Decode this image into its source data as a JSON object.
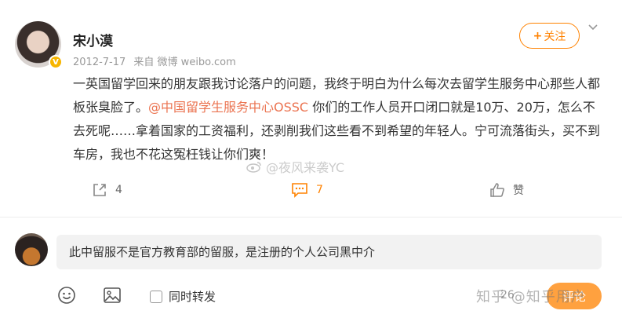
{
  "post": {
    "username": "宋小漠",
    "verified_badge": "V",
    "date": "2012-7-17",
    "source": "来自 微博 weibo.com",
    "follow_label": "关注",
    "follow_icon": "plus",
    "text_before": "一英国留学回来的朋友跟我讨论落户的问题，我终于明白为什么每次去留学生服务中心那些人都板张臭脸了。",
    "mention": "@中国留学生服务中心OSSC",
    "text_after": " 你们的工作人员开口闭口就是10万、20万，怎么不去死呢……拿着国家的工资福利，还剥削我们这些看不到希望的年轻人。宁可流落街头，买不到车房，我也不花这冤枉钱让你们爽！",
    "mention_color": "#eb7350"
  },
  "watermark_top": "@夜风来袭YC",
  "actions": {
    "repost_count": "4",
    "comment_count": "7",
    "like_label": "赞"
  },
  "reply": {
    "input_text": "此中留服不是官方教育部的留服，是注册的个人公司黑中介",
    "repost_checkbox_label": "同时转发",
    "counter": "26",
    "submit_label": "评论"
  },
  "watermark_bottom": "知乎 @知乎用户",
  "colors": {
    "accent": "#ff8200",
    "verified": "#f7b500"
  }
}
